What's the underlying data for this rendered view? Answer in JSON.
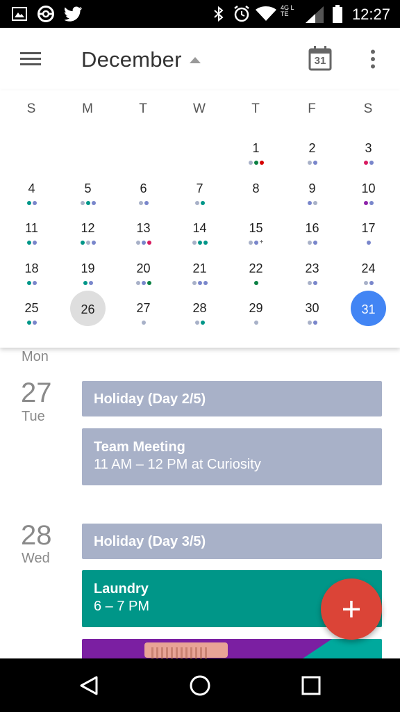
{
  "status_bar": {
    "time": "12:27",
    "left_icons": [
      "image-icon",
      "pokeball-icon",
      "twitter-icon"
    ],
    "right_icons": [
      "bluetooth-icon",
      "alarm-icon",
      "wifi-icon",
      "lte-icon",
      "signal-icon",
      "battery-icon"
    ],
    "network_label": "4G LTE"
  },
  "toolbar": {
    "menu_icon": "menu-icon",
    "month_title": "December",
    "today_icon_number": "31",
    "overflow_icon": "more-vert-icon"
  },
  "calendar": {
    "weekday_headers": [
      "S",
      "M",
      "T",
      "W",
      "T",
      "F",
      "S"
    ],
    "today_day": "26",
    "selected_day": "31",
    "today_circle_color": "#dedede",
    "selected_circle_color": "#4285f4",
    "weeks": [
      [
        {
          "day": "",
          "dots": []
        },
        {
          "day": "",
          "dots": []
        },
        {
          "day": "",
          "dots": []
        },
        {
          "day": "",
          "dots": []
        },
        {
          "day": "1",
          "dots": [
            "#a8b1c8",
            "#0b8043",
            "#d50000"
          ]
        },
        {
          "day": "2",
          "dots": [
            "#a8b1c8",
            "#7986cb"
          ]
        },
        {
          "day": "3",
          "dots": [
            "#d81b60",
            "#7986cb"
          ]
        }
      ],
      [
        {
          "day": "4",
          "dots": [
            "#009688",
            "#7986cb"
          ]
        },
        {
          "day": "5",
          "dots": [
            "#a8b1c8",
            "#009688",
            "#7986cb"
          ]
        },
        {
          "day": "6",
          "dots": [
            "#a8b1c8",
            "#7986cb"
          ]
        },
        {
          "day": "7",
          "dots": [
            "#a8b1c8",
            "#009688"
          ]
        },
        {
          "day": "8",
          "dots": []
        },
        {
          "day": "9",
          "dots": [
            "#7986cb",
            "#a8b1c8"
          ]
        },
        {
          "day": "10",
          "dots": [
            "#8e24aa",
            "#7986cb"
          ]
        }
      ],
      [
        {
          "day": "11",
          "dots": [
            "#009688",
            "#7986cb"
          ]
        },
        {
          "day": "12",
          "dots": [
            "#009688",
            "#a8b1c8",
            "#7986cb"
          ]
        },
        {
          "day": "13",
          "dots": [
            "#a8b1c8",
            "#7986cb",
            "#d81b60"
          ]
        },
        {
          "day": "14",
          "dots": [
            "#a8b1c8",
            "#009688",
            "#009688"
          ]
        },
        {
          "day": "15",
          "dots": [
            "#a8b1c8",
            "#7986cb",
            "+"
          ]
        },
        {
          "day": "16",
          "dots": [
            "#a8b1c8",
            "#7986cb"
          ]
        },
        {
          "day": "17",
          "dots": [
            "#7986cb"
          ]
        }
      ],
      [
        {
          "day": "18",
          "dots": [
            "#009688",
            "#7986cb"
          ]
        },
        {
          "day": "19",
          "dots": [
            "#009688",
            "#7986cb"
          ]
        },
        {
          "day": "20",
          "dots": [
            "#a8b1c8",
            "#7986cb",
            "#0b8043"
          ]
        },
        {
          "day": "21",
          "dots": [
            "#a8b1c8",
            "#7986cb",
            "#7986cb"
          ]
        },
        {
          "day": "22",
          "dots": [
            "#0b8043"
          ]
        },
        {
          "day": "23",
          "dots": [
            "#a8b1c8",
            "#7986cb"
          ]
        },
        {
          "day": "24",
          "dots": [
            "#a8b1c8",
            "#7986cb"
          ]
        }
      ],
      [
        {
          "day": "25",
          "dots": [
            "#009688",
            "#7986cb"
          ]
        },
        {
          "day": "26",
          "dots": []
        },
        {
          "day": "27",
          "dots": [
            "#a8b1c8"
          ]
        },
        {
          "day": "28",
          "dots": [
            "#a8b1c8",
            "#009688"
          ]
        },
        {
          "day": "29",
          "dots": [
            "#a8b1c8"
          ]
        },
        {
          "day": "30",
          "dots": [
            "#a8b1c8",
            "#7986cb"
          ]
        },
        {
          "day": "31",
          "dots": []
        }
      ]
    ]
  },
  "agenda": {
    "partial_label": "Mon",
    "days": [
      {
        "date": "27",
        "weekday": "Tue",
        "events": [
          {
            "title": "Holiday (Day 2/5)",
            "subtitle": "",
            "color": "#a8b1c8"
          },
          {
            "title": "Team Meeting",
            "subtitle": "11 AM – 12 PM at Curiosity",
            "color": "#a8b1c8"
          }
        ]
      },
      {
        "date": "28",
        "weekday": "Wed",
        "events": [
          {
            "title": "Holiday (Day 3/5)",
            "subtitle": "",
            "color": "#a8b1c8"
          },
          {
            "title": "Laundry",
            "subtitle": "6 – 7 PM",
            "color": "#009688"
          },
          {
            "title": "",
            "subtitle": "",
            "color": "#7b1fa2"
          }
        ]
      }
    ]
  },
  "fab": {
    "icon": "plus-icon",
    "color": "#db4437"
  },
  "nav_bar": {
    "icons": [
      "back-icon",
      "home-icon",
      "recents-icon"
    ]
  }
}
